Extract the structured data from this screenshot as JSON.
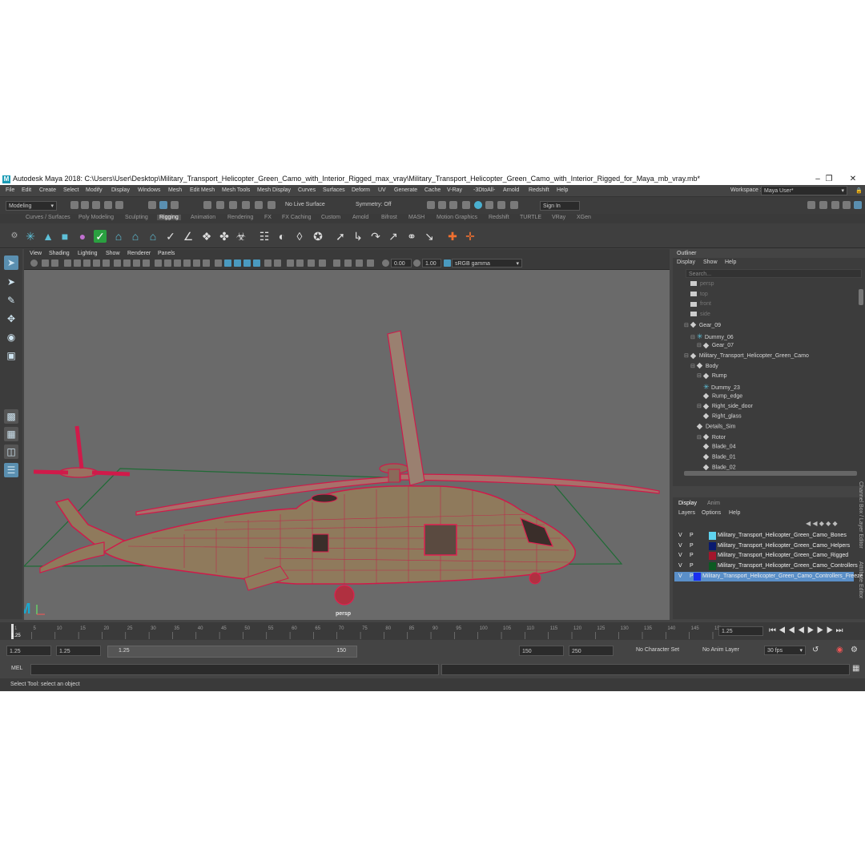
{
  "window": {
    "title": "Autodesk Maya 2018: C:\\Users\\User\\Desktop\\Military_Transport_Helicopter_Green_Camo_with_Interior_Rigged_max_vray\\Military_Transport_Helicopter_Green_Camo_with_Interior_Rigged_for_Maya_mb_vray.mb*",
    "logo": "M"
  },
  "menu": {
    "items": [
      "File",
      "Edit",
      "Create",
      "Select",
      "Modify",
      "Display",
      "Windows",
      "Mesh",
      "Edit Mesh",
      "Mesh Tools",
      "Mesh Display",
      "Curves",
      "Surfaces",
      "Deform",
      "UV",
      "Generate",
      "Cache",
      "V-Ray",
      "-3DtoAll-",
      "Arnold",
      "Redshift",
      "Help"
    ],
    "workspace_label": "Workspace :",
    "workspace_value": "Maya User*"
  },
  "status_line": {
    "mode": "Modeling",
    "live_surface": "No Live Surface",
    "symmetry": "Symmetry: Off",
    "sign_in": "Sign In"
  },
  "shelf_tabs": [
    "Curves / Surfaces",
    "Poly Modeling",
    "Sculpting",
    "Rigging",
    "Animation",
    "Rendering",
    "FX",
    "FX Caching",
    "Custom",
    "Arnold",
    "Bifrost",
    "MASH",
    "Motion Graphics",
    "Redshift",
    "TURTLE",
    "VRay",
    "XGen"
  ],
  "active_shelf_tab": "Rigging",
  "viewport": {
    "menu": [
      "View",
      "Shading",
      "Lighting",
      "Show",
      "Renderer",
      "Panels"
    ],
    "exposure": "0.00",
    "gamma": "1.00",
    "color_space": "sRGB gamma",
    "camera_label": "persp",
    "corner_logo": "M"
  },
  "outliner": {
    "title": "Outliner",
    "menu": [
      "Display",
      "Show",
      "Help"
    ],
    "search_placeholder": "Search...",
    "items": [
      {
        "label": "persp",
        "type": "camera",
        "dim": true
      },
      {
        "label": "top",
        "type": "camera",
        "dim": true
      },
      {
        "label": "front",
        "type": "camera",
        "dim": true
      },
      {
        "label": "side",
        "type": "camera",
        "dim": true
      },
      {
        "label": "Gear_09",
        "type": "node",
        "dim": false
      },
      {
        "label": "Dummy_06",
        "type": "dummy",
        "dim": false
      },
      {
        "label": "Gear_07",
        "type": "node",
        "dim": false
      },
      {
        "label": "Military_Transport_Helicopter_Green_Camo",
        "type": "node",
        "dim": false
      },
      {
        "label": "Body",
        "type": "node",
        "dim": false
      },
      {
        "label": "Rump",
        "type": "node",
        "dim": false
      },
      {
        "label": "Dummy_23",
        "type": "dummy",
        "dim": false
      },
      {
        "label": "Rump_edge",
        "type": "node",
        "dim": false
      },
      {
        "label": "Right_side_door",
        "type": "node",
        "dim": false
      },
      {
        "label": "Right_glass",
        "type": "node",
        "dim": false
      },
      {
        "label": "Details_Sim",
        "type": "node",
        "dim": false
      },
      {
        "label": "Rotor",
        "type": "node",
        "dim": false
      },
      {
        "label": "Blade_04",
        "type": "node",
        "dim": false
      },
      {
        "label": "Blade_01",
        "type": "node",
        "dim": false
      },
      {
        "label": "Blade_02",
        "type": "node",
        "dim": false
      }
    ]
  },
  "layer_editor": {
    "tabs": [
      "Display",
      "Anim"
    ],
    "menu": [
      "Layers",
      "Options",
      "Help"
    ],
    "side_tabs": [
      "Channel Box / Layer Editor",
      "Attribute Editor"
    ],
    "rows": [
      {
        "v": "V",
        "p": "P",
        "color": "#5fd3ef",
        "name": "Military_Transport_Helicopter_Green_Camo_Bones",
        "selected": false
      },
      {
        "v": "V",
        "p": "P",
        "color": "#0a1a6e",
        "name": "Military_Transport_Helicopter_Green_Camo_Helpers",
        "selected": false
      },
      {
        "v": "V",
        "p": "P",
        "color": "#a3162c",
        "name": "Military_Transport_Helicopter_Green_Camo_Rigged",
        "selected": false
      },
      {
        "v": "V",
        "p": "P",
        "color": "#0d5a22",
        "name": "Military_Transport_Helicopter_Green_Camo_Controllers",
        "selected": false
      },
      {
        "v": "V",
        "p": "P",
        "color": "#1a2ff0",
        "name": "Military_Transport_Helicopter_Green_Camo_Controllers_Freeze",
        "selected": true
      }
    ]
  },
  "timeline": {
    "ticks": [
      "1",
      "5",
      "10",
      "15",
      "20",
      "25",
      "30",
      "35",
      "40",
      "45",
      "50",
      "55",
      "60",
      "65",
      "70",
      "75",
      "80",
      "85",
      "90",
      "95",
      "100",
      "105",
      "110",
      "115",
      "120",
      "125",
      "130",
      "135",
      "140",
      "145",
      "150"
    ],
    "current_frame": "1.25",
    "current_frame_field": "1.25"
  },
  "range": {
    "start": "1.25",
    "playback_start": "1.25",
    "slider_start": "1.25",
    "slider_end": "150",
    "playback_end": "150",
    "end": "250",
    "character_set": "No Character Set",
    "anim_layer": "No Anim Layer",
    "fps": "30 fps"
  },
  "command_line": {
    "label": "MEL"
  },
  "help_line": {
    "text": "Select Tool: select an object"
  }
}
